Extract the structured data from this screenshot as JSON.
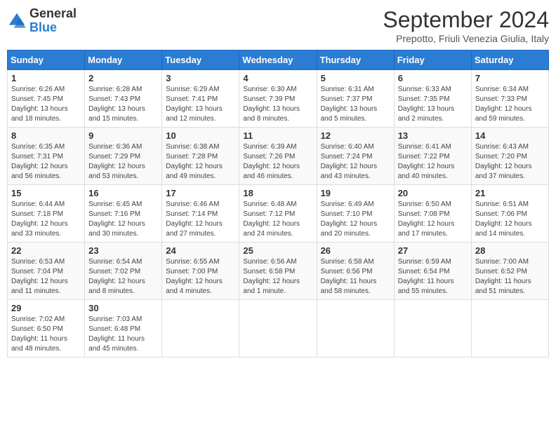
{
  "logo": {
    "general": "General",
    "blue": "Blue"
  },
  "title": "September 2024",
  "location": "Prepotto, Friuli Venezia Giulia, Italy",
  "days_header": [
    "Sunday",
    "Monday",
    "Tuesday",
    "Wednesday",
    "Thursday",
    "Friday",
    "Saturday"
  ],
  "weeks": [
    [
      {
        "day": "1",
        "sunrise": "6:26 AM",
        "sunset": "7:45 PM",
        "daylight": "13 hours and 18 minutes"
      },
      {
        "day": "2",
        "sunrise": "6:28 AM",
        "sunset": "7:43 PM",
        "daylight": "13 hours and 15 minutes"
      },
      {
        "day": "3",
        "sunrise": "6:29 AM",
        "sunset": "7:41 PM",
        "daylight": "13 hours and 12 minutes"
      },
      {
        "day": "4",
        "sunrise": "6:30 AM",
        "sunset": "7:39 PM",
        "daylight": "13 hours and 8 minutes"
      },
      {
        "day": "5",
        "sunrise": "6:31 AM",
        "sunset": "7:37 PM",
        "daylight": "13 hours and 5 minutes"
      },
      {
        "day": "6",
        "sunrise": "6:33 AM",
        "sunset": "7:35 PM",
        "daylight": "13 hours and 2 minutes"
      },
      {
        "day": "7",
        "sunrise": "6:34 AM",
        "sunset": "7:33 PM",
        "daylight": "12 hours and 59 minutes"
      }
    ],
    [
      {
        "day": "8",
        "sunrise": "6:35 AM",
        "sunset": "7:31 PM",
        "daylight": "12 hours and 56 minutes"
      },
      {
        "day": "9",
        "sunrise": "6:36 AM",
        "sunset": "7:29 PM",
        "daylight": "12 hours and 53 minutes"
      },
      {
        "day": "10",
        "sunrise": "6:38 AM",
        "sunset": "7:28 PM",
        "daylight": "12 hours and 49 minutes"
      },
      {
        "day": "11",
        "sunrise": "6:39 AM",
        "sunset": "7:26 PM",
        "daylight": "12 hours and 46 minutes"
      },
      {
        "day": "12",
        "sunrise": "6:40 AM",
        "sunset": "7:24 PM",
        "daylight": "12 hours and 43 minutes"
      },
      {
        "day": "13",
        "sunrise": "6:41 AM",
        "sunset": "7:22 PM",
        "daylight": "12 hours and 40 minutes"
      },
      {
        "day": "14",
        "sunrise": "6:43 AM",
        "sunset": "7:20 PM",
        "daylight": "12 hours and 37 minutes"
      }
    ],
    [
      {
        "day": "15",
        "sunrise": "6:44 AM",
        "sunset": "7:18 PM",
        "daylight": "12 hours and 33 minutes"
      },
      {
        "day": "16",
        "sunrise": "6:45 AM",
        "sunset": "7:16 PM",
        "daylight": "12 hours and 30 minutes"
      },
      {
        "day": "17",
        "sunrise": "6:46 AM",
        "sunset": "7:14 PM",
        "daylight": "12 hours and 27 minutes"
      },
      {
        "day": "18",
        "sunrise": "6:48 AM",
        "sunset": "7:12 PM",
        "daylight": "12 hours and 24 minutes"
      },
      {
        "day": "19",
        "sunrise": "6:49 AM",
        "sunset": "7:10 PM",
        "daylight": "12 hours and 20 minutes"
      },
      {
        "day": "20",
        "sunrise": "6:50 AM",
        "sunset": "7:08 PM",
        "daylight": "12 hours and 17 minutes"
      },
      {
        "day": "21",
        "sunrise": "6:51 AM",
        "sunset": "7:06 PM",
        "daylight": "12 hours and 14 minutes"
      }
    ],
    [
      {
        "day": "22",
        "sunrise": "6:53 AM",
        "sunset": "7:04 PM",
        "daylight": "12 hours and 11 minutes"
      },
      {
        "day": "23",
        "sunrise": "6:54 AM",
        "sunset": "7:02 PM",
        "daylight": "12 hours and 8 minutes"
      },
      {
        "day": "24",
        "sunrise": "6:55 AM",
        "sunset": "7:00 PM",
        "daylight": "12 hours and 4 minutes"
      },
      {
        "day": "25",
        "sunrise": "6:56 AM",
        "sunset": "6:58 PM",
        "daylight": "12 hours and 1 minute"
      },
      {
        "day": "26",
        "sunrise": "6:58 AM",
        "sunset": "6:56 PM",
        "daylight": "11 hours and 58 minutes"
      },
      {
        "day": "27",
        "sunrise": "6:59 AM",
        "sunset": "6:54 PM",
        "daylight": "11 hours and 55 minutes"
      },
      {
        "day": "28",
        "sunrise": "7:00 AM",
        "sunset": "6:52 PM",
        "daylight": "11 hours and 51 minutes"
      }
    ],
    [
      {
        "day": "29",
        "sunrise": "7:02 AM",
        "sunset": "6:50 PM",
        "daylight": "11 hours and 48 minutes"
      },
      {
        "day": "30",
        "sunrise": "7:03 AM",
        "sunset": "6:48 PM",
        "daylight": "11 hours and 45 minutes"
      },
      null,
      null,
      null,
      null,
      null
    ]
  ]
}
